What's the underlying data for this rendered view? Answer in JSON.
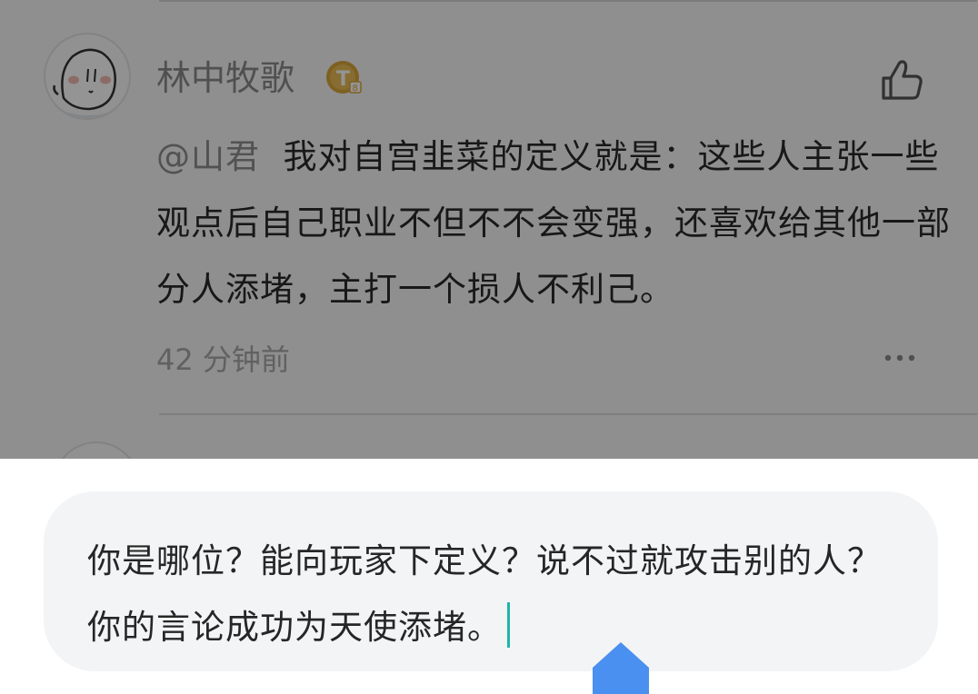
{
  "comment": {
    "username": "林中牧歌",
    "badge_icon": "gold-t-badge-icon",
    "mention": "@山君",
    "text": "我对自宫韭菜的定义就是：这些人主张一些观点后自己职业不但不不会变强，还喜欢给其他一部分人添堵，主打一个损人不利己。",
    "time": "42 分钟前",
    "like_icon": "thumbs-up-icon",
    "more_icon": "more-dots-icon"
  },
  "reply": {
    "value": "你是哪位？能向玩家下定义？说不过就攻击别的人？你的言论成功为天使添堵。"
  },
  "colors": {
    "overlay": "rgba(0,0,0,0.42)",
    "input_bg": "#f3f4f6",
    "caret": "#1fb5a8",
    "handle": "#4a90f0",
    "badge_gold": "#d9a53a"
  }
}
